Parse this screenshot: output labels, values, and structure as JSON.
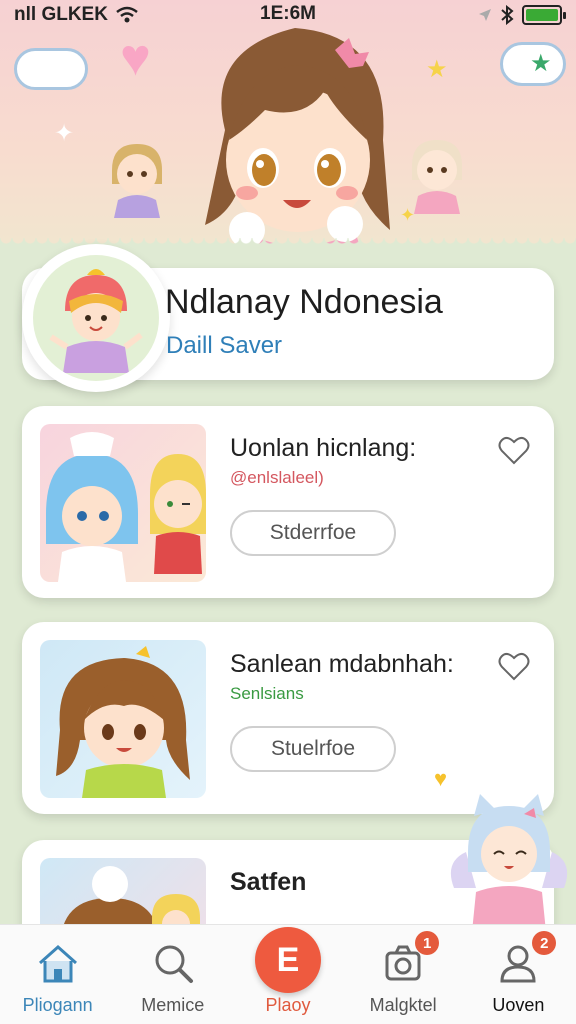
{
  "status_bar": {
    "carrier": "nll GLKEK",
    "time": "1E:6M"
  },
  "profile": {
    "name": "Ndlanay Ndonesia",
    "subtitle": "Daill Saver"
  },
  "cards": [
    {
      "title": "Uonlan hicnlang:",
      "subtitle": "@enlslaleel)",
      "subtitle_color": "#d4575f",
      "button_label": "Stderrfoe"
    },
    {
      "title": "Sanlean mdabnhah:",
      "subtitle": "Senlsians",
      "subtitle_color": "#3a9a42",
      "button_label": "Stuelrfoe"
    },
    {
      "title": "Satfen"
    }
  ],
  "bottom_nav": [
    {
      "label": "Pliogann",
      "icon": "home-icon"
    },
    {
      "label": "Memice",
      "icon": "search-icon"
    },
    {
      "label": "Plaoy",
      "icon": "play-icon",
      "glyph": "E"
    },
    {
      "label": "Malgktel",
      "icon": "camera-icon",
      "badge": "1"
    },
    {
      "label": "Uoven",
      "icon": "user-icon",
      "badge": "2"
    }
  ],
  "colors": {
    "accent": "#ee5a3f",
    "link": "#2f7fb8",
    "nav_active": "#3c86b8"
  }
}
